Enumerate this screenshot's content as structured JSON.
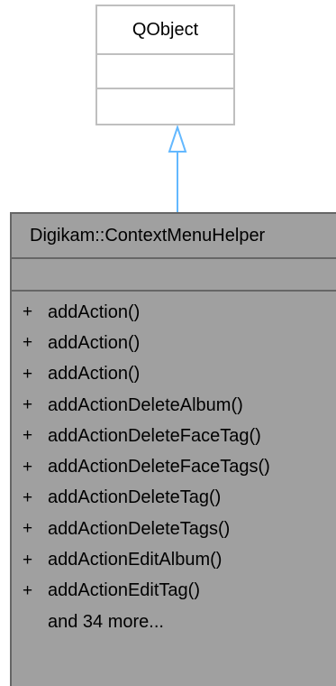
{
  "parent_class": {
    "name": "QObject"
  },
  "main_class": {
    "name": "Digikam::ContextMenuHelper",
    "methods": [
      {
        "visibility": "+",
        "name": "addAction()"
      },
      {
        "visibility": "+",
        "name": "addAction()"
      },
      {
        "visibility": "+",
        "name": "addAction()"
      },
      {
        "visibility": "+",
        "name": "addActionDeleteAlbum()"
      },
      {
        "visibility": "+",
        "name": "addActionDeleteFaceTag()"
      },
      {
        "visibility": "+",
        "name": "addActionDeleteFaceTags()"
      },
      {
        "visibility": "+",
        "name": "addActionDeleteTag()"
      },
      {
        "visibility": "+",
        "name": "addActionDeleteTags()"
      },
      {
        "visibility": "+",
        "name": "addActionEditAlbum()"
      },
      {
        "visibility": "+",
        "name": "addActionEditTag()"
      }
    ],
    "more_label": "and 34 more..."
  },
  "colors": {
    "parent_border": "#bfbfbf",
    "class_fill": "#a0a0a0",
    "class_border": "#666666",
    "arrow": "#63b8ff"
  }
}
